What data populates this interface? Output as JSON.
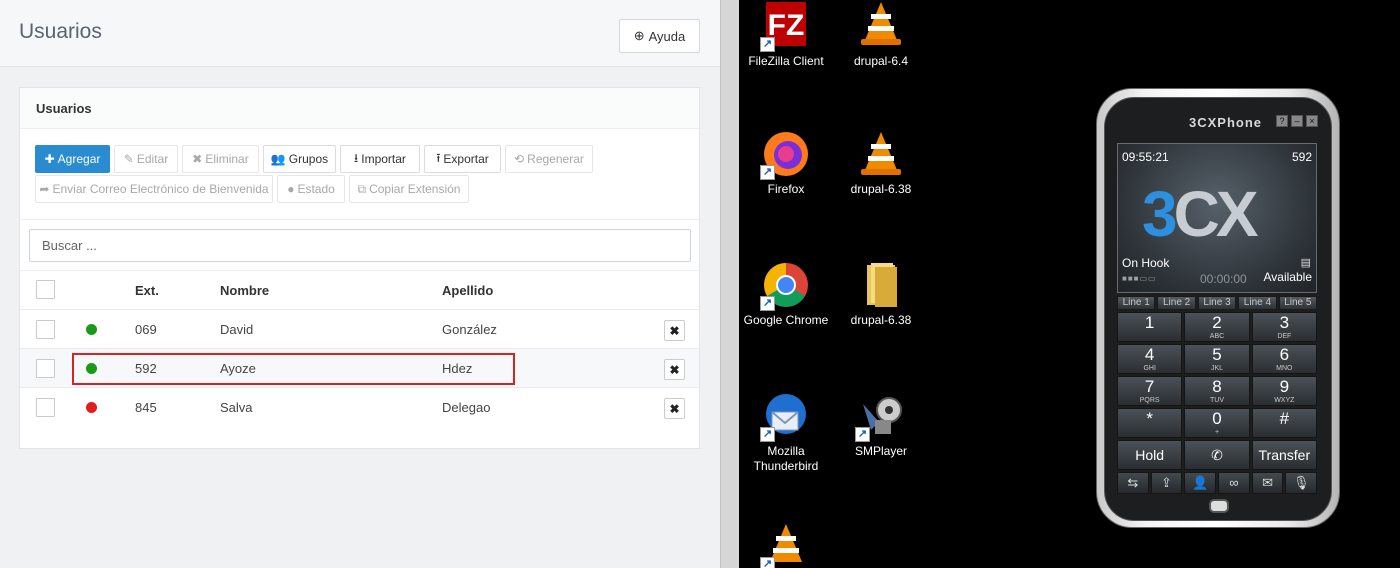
{
  "app": {
    "title": "Usuarios",
    "help_label": "Ayuda",
    "panel_title": "Usuarios",
    "toolbar": {
      "add": "Agregar",
      "edit": "Editar",
      "delete": "Eliminar",
      "groups": "Grupos",
      "import": "Importar",
      "export": "Exportar",
      "regenerate": "Regenerar",
      "welcome_email": "Enviar Correo Electrónico de Bienvenida",
      "status": "Estado",
      "copy_ext": "Copiar Extensión"
    },
    "search_placeholder": "Buscar ...",
    "columns": {
      "ext": "Ext.",
      "name": "Nombre",
      "surname": "Apellido"
    },
    "rows": [
      {
        "ext": "069",
        "name": "David",
        "surname": "González",
        "status_color": "#1a9a1a",
        "delete": "✖"
      },
      {
        "ext": "592",
        "name": "Ayoze",
        "surname": "Hdez",
        "status_color": "#1a9a1a",
        "delete": "✖"
      },
      {
        "ext": "845",
        "name": "Salva",
        "surname": "Delegao",
        "status_color": "#e31d1d",
        "delete": "✖"
      }
    ]
  },
  "desktop": {
    "icons": [
      {
        "label": "FileZilla Client",
        "icon": "filezilla-icon"
      },
      {
        "label": "drupal-6.4",
        "icon": "vlc-icon"
      },
      {
        "label": "Firefox",
        "icon": "firefox-icon"
      },
      {
        "label": "drupal-6.38",
        "icon": "vlc-icon"
      },
      {
        "label": "Google Chrome",
        "icon": "chrome-icon"
      },
      {
        "label": "drupal-6.38",
        "icon": "folder-icon"
      },
      {
        "label": "Mozilla Thunderbird",
        "icon": "thunderbird-icon"
      },
      {
        "label": "SMPlayer",
        "icon": "smplayer-icon"
      },
      {
        "label": "",
        "icon": "vlc-icon"
      }
    ]
  },
  "phone": {
    "title": "3CXPhone",
    "clock": "09:55:21",
    "extension": "592",
    "logo": "3CX",
    "status": "On Hook",
    "availability": "Available",
    "timer": "00:00:00",
    "lines": [
      "Line 1",
      "Line 2",
      "Line 3",
      "Line 4",
      "Line 5"
    ],
    "keys": [
      {
        "digit": "1",
        "sub": ""
      },
      {
        "digit": "2",
        "sub": "ABC"
      },
      {
        "digit": "3",
        "sub": "DEF"
      },
      {
        "digit": "4",
        "sub": "GHI"
      },
      {
        "digit": "5",
        "sub": "JKL"
      },
      {
        "digit": "6",
        "sub": "MNO"
      },
      {
        "digit": "7",
        "sub": "PQRS"
      },
      {
        "digit": "8",
        "sub": "TUV"
      },
      {
        "digit": "9",
        "sub": "WXYZ"
      },
      {
        "digit": "*",
        "sub": ""
      },
      {
        "digit": "0",
        "sub": "+"
      },
      {
        "digit": "#",
        "sub": ""
      }
    ],
    "hold": "Hold",
    "transfer": "Transfer"
  }
}
